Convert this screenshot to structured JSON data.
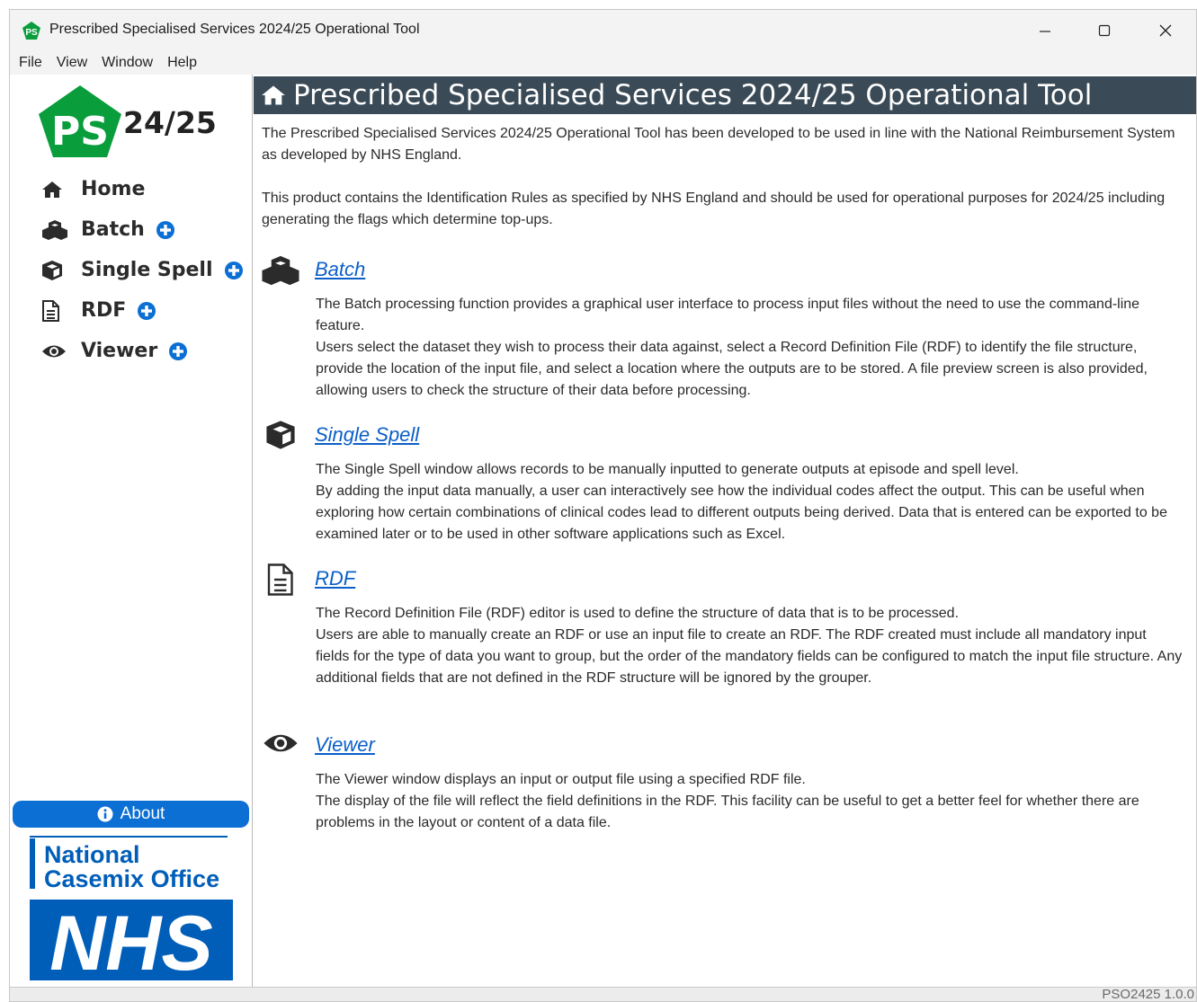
{
  "window": {
    "title": "Prescribed Specialised Services 2024/25 Operational Tool",
    "app_icon_text": "PS"
  },
  "menu": [
    "File",
    "View",
    "Window",
    "Help"
  ],
  "sidebar": {
    "logo_text": "PS",
    "logo_year": "24/25",
    "items": [
      {
        "label": "Home",
        "icon": "home-icon",
        "has_plus": false
      },
      {
        "label": "Batch",
        "icon": "cubes-icon",
        "has_plus": true
      },
      {
        "label": "Single Spell",
        "icon": "cube-icon",
        "has_plus": true
      },
      {
        "label": "RDF",
        "icon": "document-icon",
        "has_plus": true
      },
      {
        "label": "Viewer",
        "icon": "eye-icon",
        "has_plus": true
      }
    ],
    "about_label": "About",
    "nco_line1": "National",
    "nco_line2": "Casemix Office",
    "nhs_logo_text": "NHS"
  },
  "main": {
    "title": "Prescribed Specialised Services 2024/25 Operational Tool",
    "intro": [
      "The Prescribed Specialised Services 2024/25 Operational Tool has been developed to be used in line with the National Reimbursement System as developed by NHS England.",
      "This product contains the Identification Rules as specified by NHS England and should be used for operational purposes for 2024/25 including generating the flags which determine top-ups."
    ],
    "sections": [
      {
        "title": "Batch",
        "icon": "cubes-icon",
        "lines": [
          "The Batch processing function provides a graphical user interface to process input files without the need to use the command-line feature.",
          "Users select the dataset they wish to process their data against, select a Record Definition File (RDF) to identify the file structure, provide the location of the input file, and select a location where the outputs are to be stored. A file preview screen is also provided, allowing users to check the structure of their data before processing."
        ]
      },
      {
        "title": "Single Spell",
        "icon": "cube-icon",
        "lines": [
          "The Single Spell window allows records to be manually inputted to generate outputs at episode and spell level.",
          "By adding the input data manually, a user can interactively see how the individual codes affect the output. This can be useful when exploring how certain combinations of clinical codes lead to different outputs being derived. Data that is entered can be exported to be examined later or to be used in other software applications such as Excel."
        ]
      },
      {
        "title": "RDF",
        "icon": "document-icon",
        "lines": [
          "The Record Definition File (RDF) editor is used to define the structure of data that is to be processed.",
          "Users are able to manually create an RDF or use an input file to create an RDF. The RDF created must include all mandatory input fields for the type of data you want to group, but the order of the mandatory fields can be configured to match the input file structure. Any additional fields that are not defined in the RDF structure will be ignored by the grouper."
        ]
      },
      {
        "title": "Viewer",
        "icon": "eye-icon",
        "lines": [
          "The Viewer window displays an input or output file using a specified RDF file.",
          "The display of the file will reflect the field definitions in the RDF. This facility can be useful to get a better feel for whether there are problems in the layout or content of a data file."
        ]
      }
    ]
  },
  "status": {
    "version": "PSO2425 1.0.0"
  },
  "colors": {
    "header_bg": "#3a4a56",
    "accent": "#0b6fd3",
    "logo_green": "#0a9d3c",
    "nhs_blue": "#005eb8",
    "link": "#0b5fc9"
  }
}
